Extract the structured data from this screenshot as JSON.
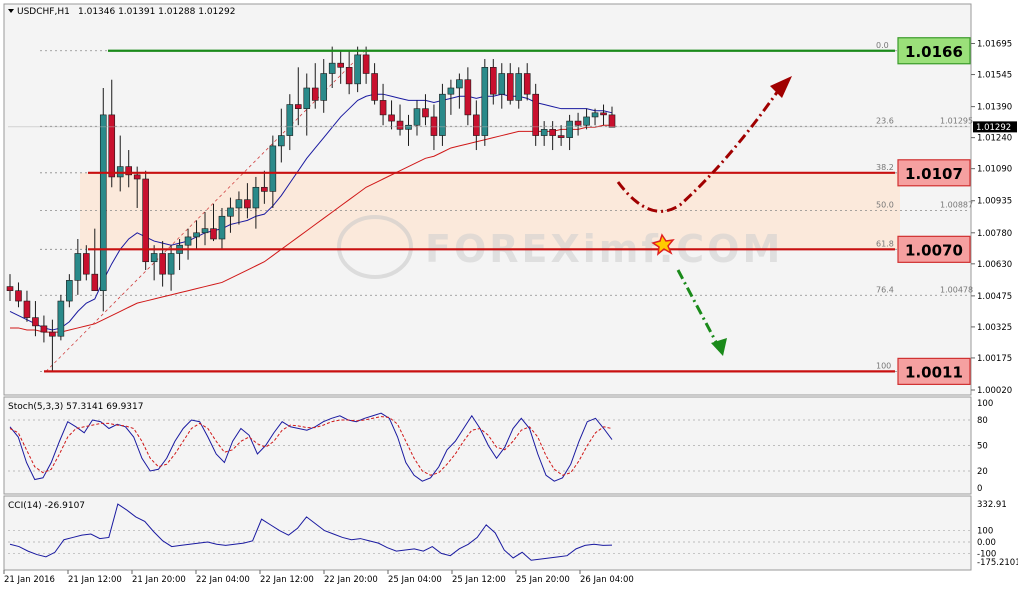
{
  "header": {
    "symbol": "USDCHF,H1",
    "ohlc": "1.01346 1.01391 1.01288 1.01292"
  },
  "chart_data": {
    "type": "candlestick",
    "symbol": "USDCHF",
    "timeframe": "H1",
    "ylim": [
      1.0002,
      1.0177
    ],
    "price_ticks": [
      "1.01695",
      "1.01545",
      "1.01390",
      "1.01240",
      "1.01090",
      "1.00935",
      "1.00780",
      "1.00630",
      "1.00475",
      "1.00325",
      "1.00175",
      "1.00020"
    ],
    "time_labels": [
      "21 Jan 2016",
      "21 Jan 12:00",
      "21 Jan 20:00",
      "22 Jan 04:00",
      "22 Jan 12:00",
      "22 Jan 20:00",
      "25 Jan 04:00",
      "25 Jan 12:00",
      "25 Jan 20:00",
      "26 Jan 04:00"
    ],
    "current_price": "1.01292",
    "candles": [
      {
        "o": 1.0052,
        "h": 1.0058,
        "l": 1.0045,
        "c": 1.005
      },
      {
        "o": 1.005,
        "h": 1.0054,
        "l": 1.0042,
        "c": 1.0045
      },
      {
        "o": 1.0045,
        "h": 1.005,
        "l": 1.0035,
        "c": 1.0037
      },
      {
        "o": 1.0037,
        "h": 1.0045,
        "l": 1.0028,
        "c": 1.0033
      },
      {
        "o": 1.0033,
        "h": 1.0038,
        "l": 1.0025,
        "c": 1.003
      },
      {
        "o": 1.003,
        "h": 1.0036,
        "l": 1.0011,
        "c": 1.0028
      },
      {
        "o": 1.0028,
        "h": 1.0048,
        "l": 1.0026,
        "c": 1.0045
      },
      {
        "o": 1.0045,
        "h": 1.0058,
        "l": 1.0042,
        "c": 1.0055
      },
      {
        "o": 1.0055,
        "h": 1.0075,
        "l": 1.0048,
        "c": 1.0068
      },
      {
        "o": 1.0068,
        "h": 1.0072,
        "l": 1.0055,
        "c": 1.0058
      },
      {
        "o": 1.0058,
        "h": 1.008,
        "l": 1.005,
        "c": 1.005
      },
      {
        "o": 1.005,
        "h": 1.0148,
        "l": 1.004,
        "c": 1.0135
      },
      {
        "o": 1.0135,
        "h": 1.0152,
        "l": 1.01,
        "c": 1.0105
      },
      {
        "o": 1.0105,
        "h": 1.0125,
        "l": 1.0098,
        "c": 1.011
      },
      {
        "o": 1.011,
        "h": 1.0118,
        "l": 1.01,
        "c": 1.0106
      },
      {
        "o": 1.0106,
        "h": 1.011,
        "l": 1.009,
        "c": 1.0104
      },
      {
        "o": 1.0104,
        "h": 1.0108,
        "l": 1.006,
        "c": 1.0064
      },
      {
        "o": 1.0064,
        "h": 1.0072,
        "l": 1.0055,
        "c": 1.0068
      },
      {
        "o": 1.0068,
        "h": 1.0074,
        "l": 1.0052,
        "c": 1.0058
      },
      {
        "o": 1.0058,
        "h": 1.0072,
        "l": 1.005,
        "c": 1.0068
      },
      {
        "o": 1.0068,
        "h": 1.0075,
        "l": 1.006,
        "c": 1.0072
      },
      {
        "o": 1.0072,
        "h": 1.008,
        "l": 1.0065,
        "c": 1.0076
      },
      {
        "o": 1.0076,
        "h": 1.0084,
        "l": 1.007,
        "c": 1.0078
      },
      {
        "o": 1.0078,
        "h": 1.0088,
        "l": 1.0072,
        "c": 1.008
      },
      {
        "o": 1.008,
        "h": 1.0092,
        "l": 1.0074,
        "c": 1.0075
      },
      {
        "o": 1.0075,
        "h": 1.009,
        "l": 1.007,
        "c": 1.0086
      },
      {
        "o": 1.0086,
        "h": 1.0095,
        "l": 1.0078,
        "c": 1.009
      },
      {
        "o": 1.009,
        "h": 1.0098,
        "l": 1.0082,
        "c": 1.0094
      },
      {
        "o": 1.0094,
        "h": 1.0102,
        "l": 1.0085,
        "c": 1.009
      },
      {
        "o": 1.009,
        "h": 1.0105,
        "l": 1.008,
        "c": 1.01
      },
      {
        "o": 1.01,
        "h": 1.0108,
        "l": 1.0092,
        "c": 1.0098
      },
      {
        "o": 1.0098,
        "h": 1.0125,
        "l": 1.009,
        "c": 1.012
      },
      {
        "o": 1.012,
        "h": 1.0138,
        "l": 1.0112,
        "c": 1.0125
      },
      {
        "o": 1.0125,
        "h": 1.0145,
        "l": 1.0118,
        "c": 1.014
      },
      {
        "o": 1.014,
        "h": 1.0158,
        "l": 1.013,
        "c": 1.0138
      },
      {
        "o": 1.0138,
        "h": 1.0155,
        "l": 1.0125,
        "c": 1.0148
      },
      {
        "o": 1.0148,
        "h": 1.016,
        "l": 1.0138,
        "c": 1.0142
      },
      {
        "o": 1.0142,
        "h": 1.0162,
        "l": 1.0136,
        "c": 1.0155
      },
      {
        "o": 1.0155,
        "h": 1.0168,
        "l": 1.0148,
        "c": 1.016
      },
      {
        "o": 1.016,
        "h": 1.0166,
        "l": 1.015,
        "c": 1.0158
      },
      {
        "o": 1.0158,
        "h": 1.0166,
        "l": 1.0145,
        "c": 1.015
      },
      {
        "o": 1.015,
        "h": 1.0168,
        "l": 1.0146,
        "c": 1.0164
      },
      {
        "o": 1.0164,
        "h": 1.0168,
        "l": 1.015,
        "c": 1.0155
      },
      {
        "o": 1.0155,
        "h": 1.016,
        "l": 1.014,
        "c": 1.0142
      },
      {
        "o": 1.0142,
        "h": 1.015,
        "l": 1.013,
        "c": 1.0135
      },
      {
        "o": 1.0135,
        "h": 1.0142,
        "l": 1.0128,
        "c": 1.0132
      },
      {
        "o": 1.0132,
        "h": 1.014,
        "l": 1.0125,
        "c": 1.0128
      },
      {
        "o": 1.0128,
        "h": 1.0135,
        "l": 1.012,
        "c": 1.013
      },
      {
        "o": 1.013,
        "h": 1.0142,
        "l": 1.0125,
        "c": 1.0138
      },
      {
        "o": 1.0138,
        "h": 1.0145,
        "l": 1.013,
        "c": 1.0134
      },
      {
        "o": 1.0134,
        "h": 1.014,
        "l": 1.0118,
        "c": 1.0125
      },
      {
        "o": 1.0125,
        "h": 1.015,
        "l": 1.012,
        "c": 1.0145
      },
      {
        "o": 1.0145,
        "h": 1.0152,
        "l": 1.0135,
        "c": 1.0148
      },
      {
        "o": 1.0148,
        "h": 1.0155,
        "l": 1.0138,
        "c": 1.0152
      },
      {
        "o": 1.0152,
        "h": 1.0158,
        "l": 1.013,
        "c": 1.0135
      },
      {
        "o": 1.0135,
        "h": 1.0142,
        "l": 1.0118,
        "c": 1.0125
      },
      {
        "o": 1.0125,
        "h": 1.0162,
        "l": 1.012,
        "c": 1.0158
      },
      {
        "o": 1.0158,
        "h": 1.0162,
        "l": 1.014,
        "c": 1.0145
      },
      {
        "o": 1.0145,
        "h": 1.016,
        "l": 1.0138,
        "c": 1.0155
      },
      {
        "o": 1.0155,
        "h": 1.016,
        "l": 1.014,
        "c": 1.0142
      },
      {
        "o": 1.0142,
        "h": 1.0158,
        "l": 1.0138,
        "c": 1.0155
      },
      {
        "o": 1.0155,
        "h": 1.016,
        "l": 1.0142,
        "c": 1.0145
      },
      {
        "o": 1.0145,
        "h": 1.015,
        "l": 1.012,
        "c": 1.0125
      },
      {
        "o": 1.0125,
        "h": 1.0132,
        "l": 1.012,
        "c": 1.0128
      },
      {
        "o": 1.0128,
        "h": 1.0132,
        "l": 1.0118,
        "c": 1.0125
      },
      {
        "o": 1.0125,
        "h": 1.013,
        "l": 1.012,
        "c": 1.0124
      },
      {
        "o": 1.0124,
        "h": 1.0135,
        "l": 1.0118,
        "c": 1.0132
      },
      {
        "o": 1.0132,
        "h": 1.0136,
        "l": 1.0125,
        "c": 1.013
      },
      {
        "o": 1.013,
        "h": 1.0138,
        "l": 1.0128,
        "c": 1.0134
      },
      {
        "o": 1.0134,
        "h": 1.0138,
        "l": 1.013,
        "c": 1.0136
      },
      {
        "o": 1.0136,
        "h": 1.014,
        "l": 1.013,
        "c": 1.0135
      },
      {
        "o": 1.0135,
        "h": 1.0139,
        "l": 1.0129,
        "c": 1.0129
      }
    ],
    "ma_blue": [
      1.004,
      1.0038,
      1.0036,
      1.0034,
      1.0032,
      1.0031,
      1.0032,
      1.0035,
      1.004,
      1.0044,
      1.0046,
      1.0055,
      1.0063,
      1.007,
      1.0075,
      1.0078,
      1.0076,
      1.0074,
      1.0073,
      1.0072,
      1.0073,
      1.0074,
      1.0076,
      1.0078,
      1.0079,
      1.008,
      1.0082,
      1.0083,
      1.0084,
      1.0086,
      1.0087,
      1.0091,
      1.0096,
      1.0102,
      1.0108,
      1.0114,
      1.0119,
      1.0124,
      1.0129,
      1.0134,
      1.0138,
      1.0142,
      1.0144,
      1.0145,
      1.0145,
      1.0144,
      1.0143,
      1.0142,
      1.0142,
      1.0142,
      1.0141,
      1.0142,
      1.0143,
      1.0144,
      1.0144,
      1.0143,
      1.0144,
      1.0144,
      1.0145,
      1.0144,
      1.0144,
      1.0143,
      1.0141,
      1.014,
      1.0139,
      1.0138,
      1.0138,
      1.0138,
      1.0138,
      1.0137,
      1.0137,
      1.0136
    ],
    "ma_red": [
      1.0032,
      1.0032,
      1.0031,
      1.0031,
      1.003,
      1.003,
      1.003,
      1.0031,
      1.0032,
      1.0033,
      1.0034,
      1.0036,
      1.0038,
      1.004,
      1.0042,
      1.0044,
      1.0045,
      1.0046,
      1.0047,
      1.0048,
      1.0049,
      1.005,
      1.0051,
      1.0052,
      1.0053,
      1.0054,
      1.0056,
      1.0058,
      1.006,
      1.0062,
      1.0064,
      1.0067,
      1.007,
      1.0073,
      1.0076,
      1.0079,
      1.0082,
      1.0085,
      1.0088,
      1.0091,
      1.0094,
      1.0097,
      1.01,
      1.0102,
      1.0104,
      1.0106,
      1.0108,
      1.011,
      1.0112,
      1.0114,
      1.0115,
      1.0117,
      1.0119,
      1.012,
      1.0121,
      1.0122,
      1.0123,
      1.0124,
      1.0125,
      1.0126,
      1.0127,
      1.0127,
      1.0127,
      1.0127,
      1.0127,
      1.0128,
      1.0128,
      1.0128,
      1.0129,
      1.0129,
      1.013,
      1.013
    ],
    "horizontal_levels": [
      {
        "label": "1.0166",
        "price": 1.0166,
        "style": "green"
      },
      {
        "label": "1.0107",
        "price": 1.0107,
        "style": "red"
      },
      {
        "label": "1.0070",
        "price": 1.007,
        "style": "red"
      },
      {
        "label": "1.0011",
        "price": 1.0011,
        "style": "red"
      }
    ],
    "fibonacci": {
      "levels": [
        {
          "ratio": "0.0",
          "price": 1.0166
        },
        {
          "ratio": "23.6",
          "price": 1.01295,
          "price_label": "1.01295"
        },
        {
          "ratio": "38.2",
          "price": 1.0107
        },
        {
          "ratio": "50.0",
          "price": 1.00887,
          "price_label": "1.00887"
        },
        {
          "ratio": "61.8",
          "price": 1.007
        },
        {
          "ratio": "76.4",
          "price": 1.00478,
          "price_label": "1.00478"
        },
        {
          "ratio": "100",
          "price": 1.0011
        }
      ]
    },
    "stochastic": {
      "header": "Stoch(5,3,3) 57.3141 69.9317",
      "ticks": [
        "100",
        "80",
        "50",
        "20",
        "0"
      ],
      "main": [
        72,
        60,
        30,
        10,
        12,
        30,
        55,
        78,
        72,
        65,
        80,
        78,
        70,
        75,
        72,
        60,
        35,
        20,
        22,
        35,
        55,
        70,
        80,
        78,
        60,
        40,
        30,
        55,
        70,
        62,
        40,
        50,
        65,
        78,
        72,
        70,
        68,
        72,
        78,
        82,
        85,
        80,
        78,
        82,
        85,
        88,
        82,
        60,
        30,
        15,
        8,
        12,
        25,
        45,
        55,
        70,
        85,
        70,
        50,
        35,
        48,
        70,
        82,
        70,
        40,
        15,
        8,
        12,
        28,
        55,
        78,
        82,
        70,
        57
      ],
      "signal": [
        70,
        65,
        45,
        25,
        18,
        22,
        40,
        60,
        70,
        72,
        74,
        76,
        76,
        74,
        73,
        70,
        55,
        35,
        25,
        28,
        40,
        55,
        70,
        76,
        70,
        55,
        42,
        45,
        55,
        60,
        52,
        48,
        55,
        68,
        74,
        73,
        71,
        71,
        74,
        78,
        80,
        80,
        79,
        80,
        82,
        84,
        83,
        75,
        55,
        35,
        20,
        15,
        18,
        28,
        40,
        55,
        68,
        70,
        62,
        48,
        45,
        55,
        68,
        72,
        60,
        38,
        22,
        15,
        18,
        32,
        50,
        65,
        72,
        70
      ]
    },
    "cci": {
      "header": "CCI(14) -26.9107",
      "ticks": [
        "332.91",
        "100",
        "0.00",
        "-100",
        "-175.2101"
      ],
      "values": [
        -20,
        -40,
        -80,
        -110,
        -130,
        -90,
        20,
        40,
        60,
        70,
        30,
        40,
        332,
        280,
        220,
        180,
        90,
        10,
        -40,
        -30,
        -20,
        -10,
        0,
        -20,
        -30,
        -20,
        -10,
        10,
        200,
        150,
        100,
        60,
        120,
        220,
        160,
        100,
        70,
        40,
        20,
        30,
        10,
        -10,
        -50,
        -80,
        -70,
        -60,
        -80,
        -40,
        -100,
        -120,
        -60,
        -20,
        40,
        150,
        80,
        -70,
        -140,
        -90,
        -160,
        -150,
        -140,
        -130,
        -120,
        -60,
        -30,
        -20,
        -30,
        -27
      ]
    },
    "watermark": "FOREXimf.COM"
  }
}
